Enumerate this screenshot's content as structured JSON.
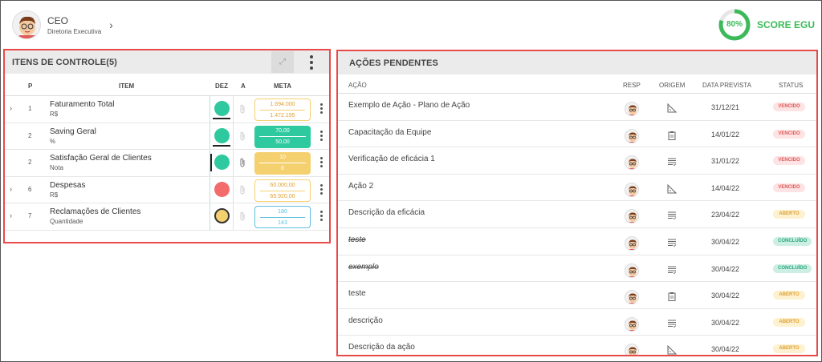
{
  "header": {
    "role": "CEO",
    "department": "Diretoria Executiva"
  },
  "score": {
    "value": "80%",
    "percent": 80,
    "label": "SCORE EGU",
    "color": "#3cba5a"
  },
  "left_panel": {
    "title": "ITENS DE CONTROLE(5)",
    "columns": {
      "p": "P",
      "item": "ITEM",
      "dez": "DEZ",
      "a": "A",
      "meta": "META"
    },
    "rows": [
      {
        "p": "1",
        "name": "Faturamento Total",
        "unit": "R$",
        "status": "green",
        "meta1": "1.694.000",
        "meta2": "1.472.195",
        "meta_style": "outline-yellow",
        "expandable": true,
        "attachment": false
      },
      {
        "p": "2",
        "name": "Saving Geral",
        "unit": "%",
        "status": "green",
        "meta1": "70,00",
        "meta2": "50,00",
        "meta_style": "filled-green",
        "expandable": false,
        "attachment": false
      },
      {
        "p": "2",
        "name": "Satisfação Geral de Clientes",
        "unit": "Nota",
        "status": "green",
        "meta1": "10",
        "meta2": "8",
        "meta_style": "filled-yellow",
        "expandable": false,
        "attachment": true
      },
      {
        "p": "6",
        "name": "Despesas",
        "unit": "R$",
        "status": "red",
        "meta1": "60.000,00",
        "meta2": "65.920,00",
        "meta_style": "outline-yellow",
        "expandable": true,
        "attachment": false
      },
      {
        "p": "7",
        "name": "Reclamações de Clientes",
        "unit": "Quantidade",
        "status": "yellow",
        "meta1": "180",
        "meta2": "143",
        "meta_style": "outline-blue",
        "expandable": true,
        "attachment": false
      }
    ]
  },
  "right_panel": {
    "title": "AÇÕES PENDENTES",
    "columns": {
      "acao": "AÇÃO",
      "resp": "RESP",
      "origem": "ORIGEM",
      "data": "DATA PREVISTA",
      "status": "STATUS"
    },
    "rows": [
      {
        "desc": "Exemplo de Ação - Plano de Ação",
        "origin": "ruler-icon",
        "date": "31/12/21",
        "status": "VENCIDO",
        "done": false
      },
      {
        "desc": "Capacitação da Equipe",
        "origin": "clipboard-icon",
        "date": "14/01/22",
        "status": "VENCIDO",
        "done": false
      },
      {
        "desc": "Verificação de eficácia 1",
        "origin": "list-check-icon",
        "date": "31/01/22",
        "status": "VENCIDO",
        "done": false
      },
      {
        "desc": "Ação 2",
        "origin": "ruler-icon",
        "date": "14/04/22",
        "status": "VENCIDO",
        "done": false
      },
      {
        "desc": "Descrição da eficácia",
        "origin": "list-check-icon",
        "date": "23/04/22",
        "status": "ABERTO",
        "done": false
      },
      {
        "desc": "teste",
        "origin": "list-check-icon",
        "date": "30/04/22",
        "status": "CONCLUÍDO",
        "done": true
      },
      {
        "desc": "exemplo",
        "origin": "list-check-icon",
        "date": "30/04/22",
        "status": "CONCLUÍDO",
        "done": true
      },
      {
        "desc": "teste",
        "origin": "clipboard-icon",
        "date": "30/04/22",
        "status": "ABERTO",
        "done": false
      },
      {
        "desc": "descrição",
        "origin": "list-check-icon",
        "date": "30/04/22",
        "status": "ABERTO",
        "done": false
      },
      {
        "desc": "Descrição da ação",
        "origin": "ruler-icon",
        "date": "30/04/22",
        "status": "ABERTO",
        "done": false
      }
    ]
  },
  "colors": {
    "green": "#2ec99e",
    "red": "#f46b6b",
    "yellow": "#f4d06f",
    "blue": "#5bc0de",
    "panel_border": "#e84a4a"
  }
}
